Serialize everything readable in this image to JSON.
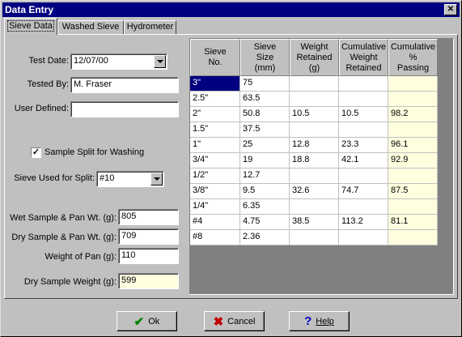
{
  "window": {
    "title": "Data Entry"
  },
  "tabs": [
    {
      "label": "Sieve Data"
    },
    {
      "label": "Washed Sieve"
    },
    {
      "label": "Hydrometer"
    }
  ],
  "form": {
    "test_date_label": "Test Date:",
    "test_date_value": "12/07/00",
    "tested_by_label": "Tested By:",
    "tested_by_value": "M. Fraser",
    "user_defined_label": "User Defined:",
    "user_defined_value": "",
    "sample_split_label": "Sample Split for Washing",
    "sample_split_checked": true,
    "sieve_split_label": "Sieve Used for Split:",
    "sieve_split_value": "#10",
    "wet_sample_label": "Wet Sample & Pan Wt. (g):",
    "wet_sample_value": "805",
    "dry_sample_label": "Dry Sample & Pan Wt. (g):",
    "dry_sample_value": "709",
    "pan_weight_label": "Weight of Pan (g):",
    "pan_weight_value": "110",
    "dry_weight_label": "Dry Sample Weight (g):",
    "dry_weight_value": "599"
  },
  "grid": {
    "headers": [
      "Sieve\nNo.",
      "Sieve\nSize\n(mm)",
      "Weight\nRetained\n(g)",
      "Cumulative\nWeight\nRetained",
      "Cumulative\n%\nPassing"
    ],
    "rows": [
      [
        "3\"",
        "75",
        "",
        "",
        ""
      ],
      [
        "2.5\"",
        "63.5",
        "",
        "",
        ""
      ],
      [
        "2\"",
        "50.8",
        "10.5",
        "10.5",
        "98.2"
      ],
      [
        "1.5\"",
        "37.5",
        "",
        "",
        ""
      ],
      [
        "1\"",
        "25",
        "12.8",
        "23.3",
        "96.1"
      ],
      [
        "3/4\"",
        "19",
        "18.8",
        "42.1",
        "92.9"
      ],
      [
        "1/2\"",
        "12.7",
        "",
        "",
        ""
      ],
      [
        "3/8\"",
        "9.5",
        "32.6",
        "74.7",
        "87.5"
      ],
      [
        "1/4\"",
        "6.35",
        "",
        "",
        ""
      ],
      [
        "#4",
        "4.75",
        "38.5",
        "113.2",
        "81.1"
      ],
      [
        "#8",
        "2.36",
        "",
        "",
        ""
      ]
    ]
  },
  "buttons": {
    "ok_label": "Ok",
    "cancel_label": "Cancel",
    "help_label": "Help"
  },
  "colors": {
    "title_bar": "#000080",
    "ok_icon": "#008000",
    "cancel_icon": "#c00000",
    "help_icon": "#0000c0",
    "passing_column": "#ffffe0"
  },
  "icons": {
    "ok": "checkmark-icon",
    "cancel": "x-icon",
    "help": "question-icon"
  }
}
